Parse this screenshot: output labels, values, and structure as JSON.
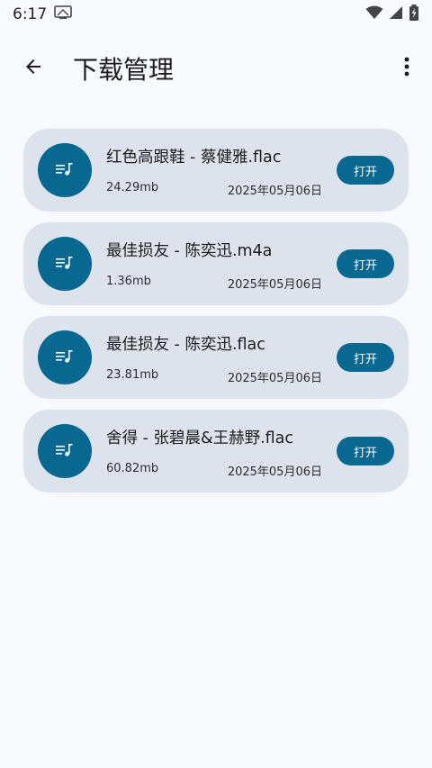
{
  "status_bar": {
    "time": "6:17",
    "icons": [
      "screen-cast-icon",
      "wifi-icon",
      "signal-icon",
      "battery-charging-icon"
    ]
  },
  "app_bar": {
    "title": "下载管理",
    "back_icon": "arrow-back-icon",
    "menu_icon": "more-vert-icon"
  },
  "colors": {
    "accent": "#086891",
    "card_bg": "#dde3ec",
    "page_bg": "#f7fafe"
  },
  "downloads": [
    {
      "name": "红色高跟鞋 - 蔡健雅.flac",
      "size": "24.29mb",
      "date": "2025年05月06日",
      "action": "打开",
      "icon": "music-queue-icon"
    },
    {
      "name": "最佳损友 - 陈奕迅.m4a",
      "size": "1.36mb",
      "date": "2025年05月06日",
      "action": "打开",
      "icon": "music-queue-icon"
    },
    {
      "name": "最佳损友 - 陈奕迅.flac",
      "size": "23.81mb",
      "date": "2025年05月06日",
      "action": "打开",
      "icon": "music-queue-icon"
    },
    {
      "name": "舍得 - 张碧晨&王赫野.flac",
      "size": "60.82mb",
      "date": "2025年05月06日",
      "action": "打开",
      "icon": "music-queue-icon"
    }
  ]
}
